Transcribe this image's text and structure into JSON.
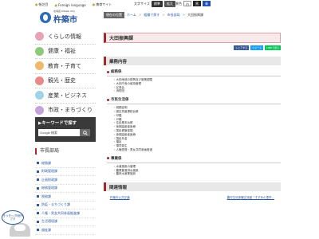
{
  "top_links": [
    "帳芝目",
    "Foreign language",
    "携帯サイト"
  ],
  "font_size": {
    "label": "文字サイズ",
    "small": "標準",
    "large": "拡大"
  },
  "color_switch": {
    "label": "背景色",
    "options": [
      "白",
      "黒",
      "青"
    ]
  },
  "logo": {
    "sub": "北海道 Kitaaki City",
    "main": "杵築市"
  },
  "nav": [
    {
      "label": "くらしの情報",
      "color": "#e8a2b6"
    },
    {
      "label": "健康・福祉",
      "color": "#8cc97a"
    },
    {
      "label": "教育・子育て",
      "color": "#f0b86a"
    },
    {
      "label": "観光・歴史",
      "color": "#e88a8a"
    },
    {
      "label": "産業・ビジネス",
      "color": "#9fd3e6"
    },
    {
      "label": "市政・まちづくり",
      "color": "#c4a3d9"
    }
  ],
  "keyword": {
    "title": "▶キーワードで探す",
    "placeholder": "Google 検索"
  },
  "dept": {
    "heading": "市長部局",
    "items": [
      "総務課",
      "財政管理課",
      "企画財政課",
      "総務管理課",
      "税務課",
      "防疫・まちづくり課",
      "人権・男女共同参画推進課",
      "生活環境課",
      "福祉課"
    ]
  },
  "mascot": {
    "text": "きつきっ\n市役所です"
  },
  "breadcrumb": {
    "current_label": "現在の位置",
    "items": [
      "ホーム",
      "組織で探す",
      "市長部局",
      "大田振興課"
    ]
  },
  "page_title": "大田振興課",
  "share": {
    "facebook": "シェアする",
    "twitter": "ツイート",
    "line": "LINEで送る"
  },
  "section_title": "業務内容",
  "groups": [
    {
      "title": "総務係",
      "items": [
        "大田地域の振興及び施策調整",
        "大田庁舎の維持管理",
        "区長会",
        "消防団"
      ]
    },
    {
      "title": "市民生活係",
      "items": [
        "税務証明",
        "固定資産課税台帳",
        "印鑑",
        "戸籍",
        "住民基本台帳",
        "後期高齢者医療",
        "国民健康保険",
        "後期高齢者医療",
        "国民年金",
        "福祉",
        "環境衛生",
        "人権啓発・男女共同参画推進"
      ]
    },
    {
      "title": "事業係",
      "items": [
        "水道施設の管理",
        "農業集落排水施設",
        "農林水産業施設"
      ]
    }
  ],
  "related_title": "関連情報",
  "related": [
    "杵築市公共交通",
    "農村文化体験交流館「すずめの里杵..."
  ],
  "colors": {
    "accent": "#a02a2a",
    "link": "#2a5aa0",
    "sidebar_dark": "#3a3a3a"
  }
}
